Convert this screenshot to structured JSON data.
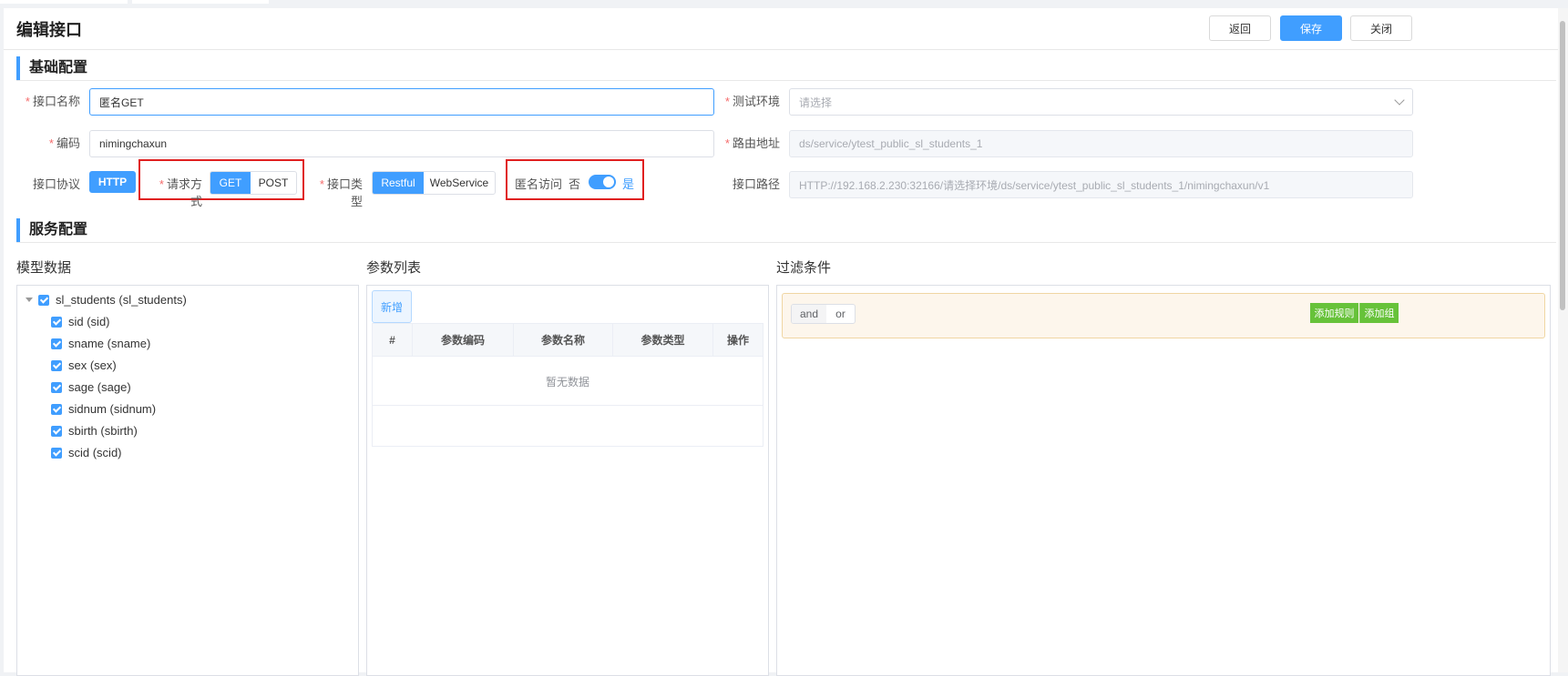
{
  "header": {
    "title": "编辑接口",
    "back_label": "返回",
    "save_label": "保存",
    "close_label": "关闭"
  },
  "basic": {
    "section_title": "基础配置",
    "name_label": "接口名称",
    "name_value": "匿名GET",
    "env_label": "测试环境",
    "env_placeholder": "请选择",
    "code_label": "编码",
    "code_value": "nimingchaxun",
    "route_label": "路由地址",
    "route_value": "ds/service/ytest_public_sl_students_1",
    "protocol_label": "接口协议",
    "protocol_value": "HTTP",
    "method_label": "请求方式",
    "method_options": [
      "GET",
      "POST"
    ],
    "type_label": "接口类型",
    "type_options": [
      "Restful",
      "WebService"
    ],
    "anon_label": "匿名访问",
    "anon_off": "否",
    "anon_on": "是",
    "path_label": "接口路径",
    "path_value": "HTTP://192.168.2.230:32166/请选择环境/ds/service/ytest_public_sl_students_1/nimingchaxun/v1"
  },
  "service": {
    "section_title": "服务配置",
    "model_title": "模型数据",
    "tree_root": "sl_students (sl_students)",
    "tree_items": [
      "sid (sid)",
      "sname (sname)",
      "sex (sex)",
      "sage (sage)",
      "sidnum (sidnum)",
      "sbirth (sbirth)",
      "scid (scid)"
    ],
    "params_title": "参数列表",
    "add_label": "新增",
    "columns": [
      "#",
      "参数编码",
      "参数名称",
      "参数类型",
      "操作"
    ],
    "empty_text": "暂无数据",
    "filter_title": "过滤条件",
    "and_label": "and",
    "or_label": "or",
    "add_rule_label": "添加规则",
    "add_group_label": "添加组"
  },
  "colors": {
    "accent": "#409eff",
    "required": "#f56c6c",
    "highlight": "#e02020",
    "green": "#67c23a"
  }
}
